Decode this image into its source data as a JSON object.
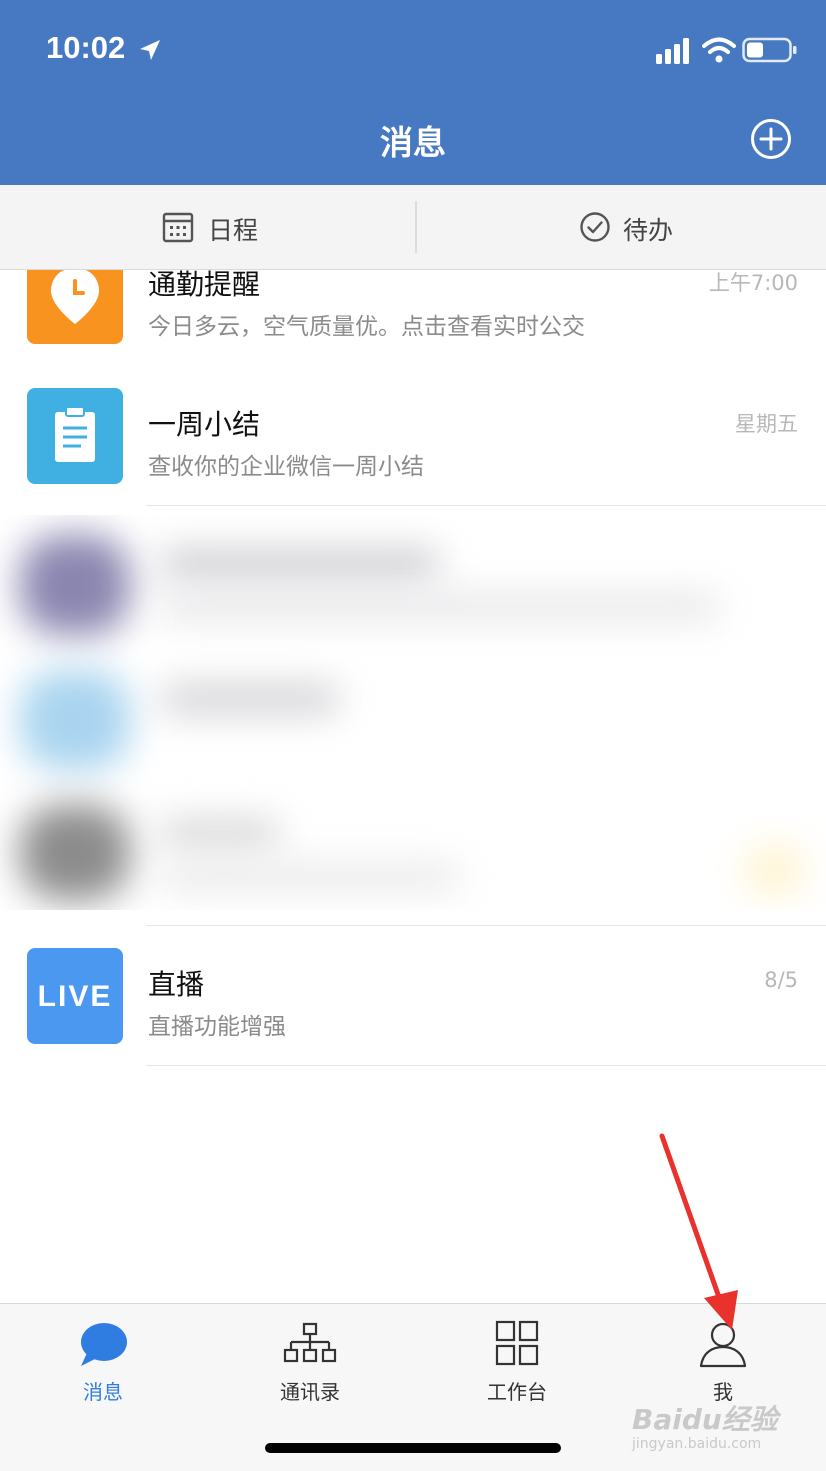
{
  "status_bar": {
    "time": "10:02"
  },
  "header": {
    "title": "消息",
    "add_icon": "plus-circle-icon"
  },
  "segments": [
    {
      "label": "日程",
      "icon": "calendar-icon"
    },
    {
      "label": "待办",
      "icon": "check-circle-icon"
    }
  ],
  "messages": [
    {
      "title": "通勤提醒",
      "subtitle": "今日多云，空气质量优。点击查看实时公交",
      "time": "上午7:00",
      "icon": "commute-reminder-icon",
      "color": "#f7931e"
    },
    {
      "title": "一周小结",
      "subtitle": "查收你的企业微信一周小结",
      "time": "星期五",
      "icon": "clipboard-icon",
      "color": "#3fb0e1"
    },
    {
      "title": "直播",
      "subtitle": "直播功能增强",
      "time": "8/5",
      "icon_text": "LIVE",
      "color": "#4a98f0"
    }
  ],
  "tabbar": {
    "tabs": [
      {
        "label": "消息",
        "icon": "chat-bubble-icon",
        "active": true
      },
      {
        "label": "通讯录",
        "icon": "org-chart-icon",
        "active": false
      },
      {
        "label": "工作台",
        "icon": "grid-icon",
        "active": false
      },
      {
        "label": "我",
        "icon": "person-icon",
        "active": false
      }
    ]
  },
  "colors": {
    "header": "#4679c1",
    "active_tab": "#2f7de1",
    "annotation": "#e8322b"
  },
  "watermark": {
    "main": "Baidu经验",
    "sub": "jingyan.baidu.com"
  }
}
